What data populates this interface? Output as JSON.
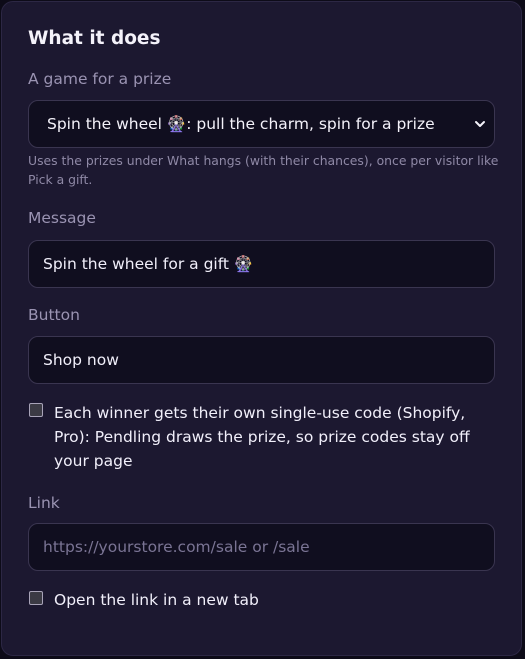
{
  "section": {
    "title": "What it does"
  },
  "game": {
    "label": "A game for a prize",
    "selected": "Spin the wheel 🎡: pull the charm, spin for a prize",
    "hint": "Uses the prizes under What hangs (with their chances), once per visitor like Pick a gift."
  },
  "message": {
    "label": "Message",
    "value": "Spin the wheel for a gift 🎡"
  },
  "button_field": {
    "label": "Button",
    "value": "Shop now"
  },
  "unique_code": {
    "label": "Each winner gets their own single-use code (Shopify, Pro): Pendling draws the prize, so prize codes stay off your page",
    "checked": false
  },
  "link": {
    "label": "Link",
    "placeholder": "https://yourstore.com/sale or /sale",
    "value": ""
  },
  "new_tab": {
    "label": "Open the link in a new tab",
    "checked": false
  },
  "colors": {
    "panel_bg": "#1c1830",
    "field_bg": "#100e1f",
    "label_text": "#9a93b2",
    "primary_text": "#f1effa"
  },
  "icons": {
    "select_arrow": "chevron-down-icon"
  }
}
